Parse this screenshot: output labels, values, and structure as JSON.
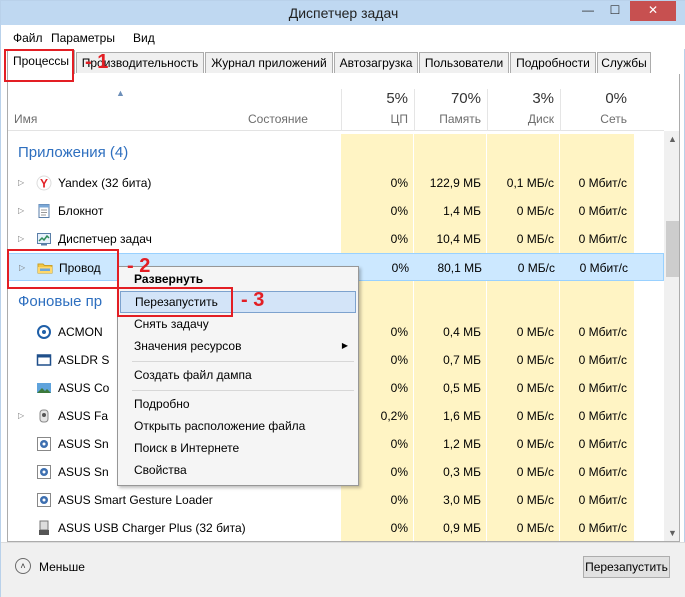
{
  "window": {
    "title": "Диспетчер задач",
    "min_glyph": "—",
    "max_glyph": "☐",
    "close_glyph": "✕"
  },
  "menu": [
    "Файл",
    "Параметры",
    "Вид"
  ],
  "tabs": [
    "Процессы",
    "Производительность",
    "Журнал приложений",
    "Автозагрузка",
    "Пользователи",
    "Подробности",
    "Службы"
  ],
  "active_tab": "Процессы",
  "columns": {
    "name": "Имя",
    "status": "Состояние",
    "cpu": {
      "pct": "5%",
      "label": "ЦП"
    },
    "memory": {
      "pct": "70%",
      "label": "Память"
    },
    "disk": {
      "pct": "3%",
      "label": "Диск"
    },
    "network": {
      "pct": "0%",
      "label": "Сеть"
    }
  },
  "groups": {
    "apps": "Приложения (4)",
    "background": "Фоновые пр"
  },
  "apps": [
    {
      "name": "Yandex (32 бита)",
      "cpu": "0%",
      "mem": "122,9 МБ",
      "disk": "0,1 МБ/с",
      "net": "0 Мбит/с"
    },
    {
      "name": "Блокнот",
      "cpu": "0%",
      "mem": "1,4 МБ",
      "disk": "0 МБ/с",
      "net": "0 Мбит/с"
    },
    {
      "name": "Диспетчер задач",
      "cpu": "0%",
      "mem": "10,4 МБ",
      "disk": "0 МБ/с",
      "net": "0 Мбит/с"
    },
    {
      "name": "Провод",
      "cpu": "0%",
      "mem": "80,1 МБ",
      "disk": "0 МБ/с",
      "net": "0 Мбит/с"
    }
  ],
  "background": [
    {
      "name": "ACMON",
      "cpu": "0%",
      "mem": "0,4 МБ",
      "disk": "0 МБ/с",
      "net": "0 Мбит/с"
    },
    {
      "name": "ASLDR S",
      "cpu": "0%",
      "mem": "0,7 МБ",
      "disk": "0 МБ/с",
      "net": "0 Мбит/с"
    },
    {
      "name": "ASUS Co",
      "cpu": "0%",
      "mem": "0,5 МБ",
      "disk": "0 МБ/с",
      "net": "0 Мбит/с"
    },
    {
      "name": "ASUS Fa",
      "cpu": "0,2%",
      "mem": "1,6 МБ",
      "disk": "0 МБ/с",
      "net": "0 Мбит/с"
    },
    {
      "name": "ASUS Sn",
      "cpu": "0%",
      "mem": "1,2 МБ",
      "disk": "0 МБ/с",
      "net": "0 Мбит/с"
    },
    {
      "name": "ASUS Sn",
      "cpu": "0%",
      "mem": "0,3 МБ",
      "disk": "0 МБ/с",
      "net": "0 Мбит/с"
    },
    {
      "name": "ASUS Smart Gesture Loader",
      "cpu": "0%",
      "mem": "3,0 МБ",
      "disk": "0 МБ/с",
      "net": "0 Мбит/с"
    },
    {
      "name": "ASUS USB Charger Plus (32 бита)",
      "cpu": "0%",
      "mem": "0,9 МБ",
      "disk": "0 МБ/с",
      "net": "0 Мбит/с"
    }
  ],
  "context_menu": {
    "expand": "Развернуть",
    "restart": "Перезапустить",
    "end_task": "Снять задачу",
    "resource_values": "Значения ресурсов",
    "dump": "Создать файл дампа",
    "details": "Подробно",
    "open_location": "Открыть расположение файла",
    "search_online": "Поиск в Интернете",
    "properties": "Свойства"
  },
  "footer": {
    "less": "Меньше",
    "restart_button": "Перезапустить"
  },
  "annotations": [
    "- 1",
    "- 2",
    "- 3"
  ],
  "colors": {
    "accent": "#2e6fbf",
    "heat": "#fff4c4",
    "selection": "#cce8ff",
    "annotation": "#e31e24"
  }
}
